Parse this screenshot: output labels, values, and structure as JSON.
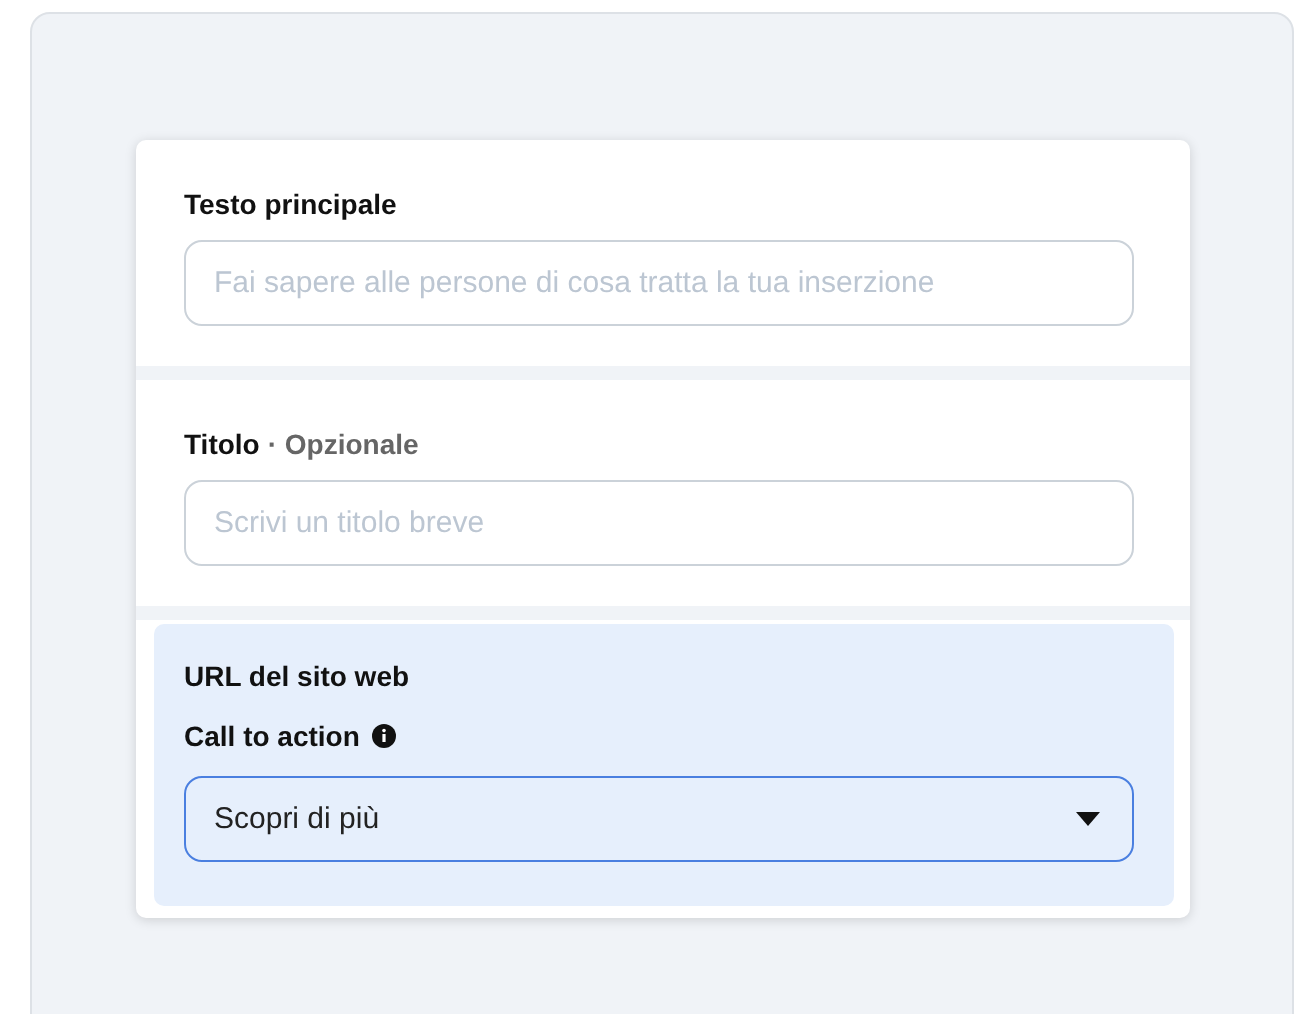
{
  "sections": [
    {
      "kind": "text",
      "label": "Testo principale",
      "placeholder": "Fai sapere alle persone di cosa tratta la tua inserzione"
    },
    {
      "kind": "text",
      "label": "Titolo",
      "suffix": "· Opzionale",
      "placeholder": "Scrivi un titolo breve"
    },
    {
      "kind": "select",
      "label": "URL del sito web",
      "sublabel": "Call to action",
      "value": "Scopri di più"
    }
  ]
}
